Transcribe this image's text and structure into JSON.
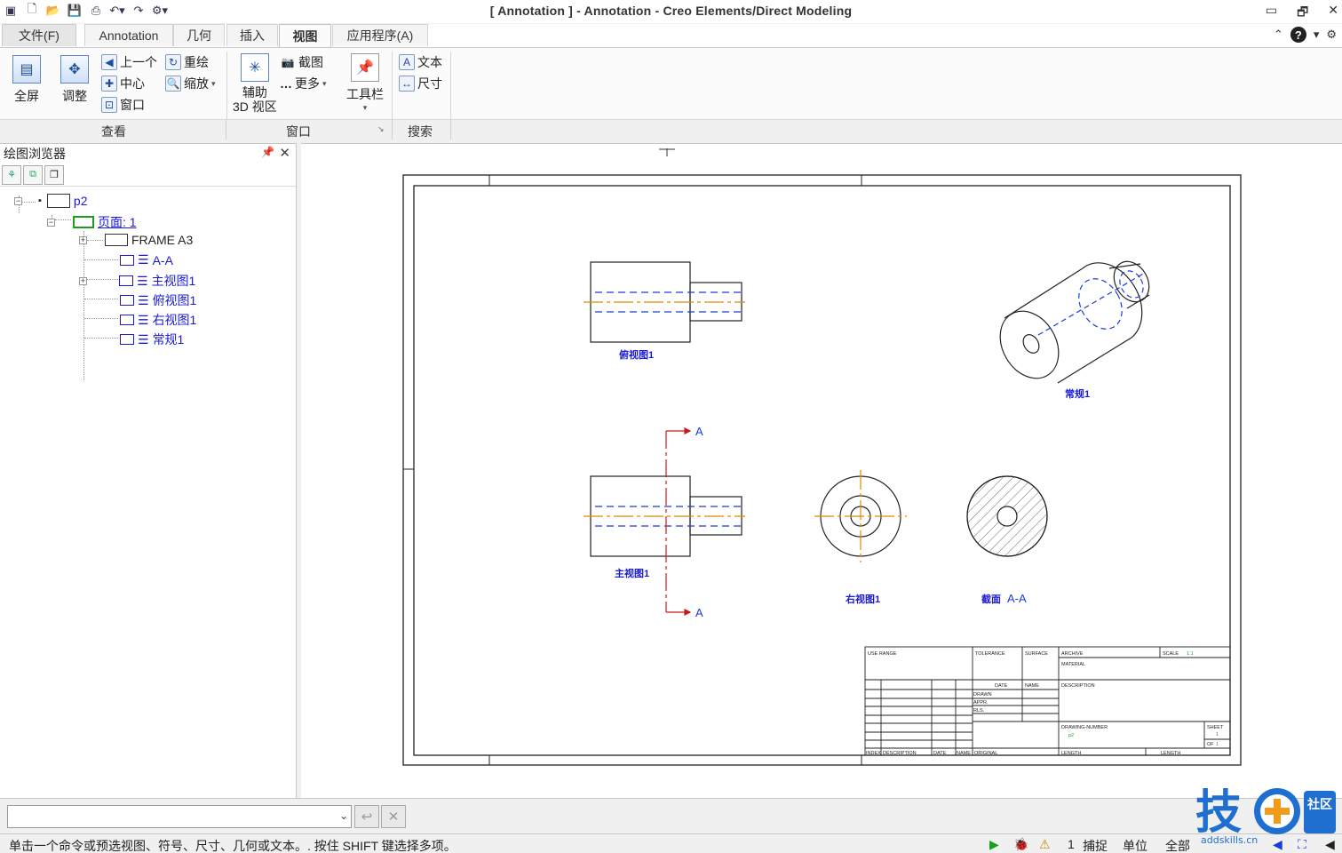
{
  "window": {
    "title": "[ Annotation ] - Annotation - Creo Elements/Direct Modeling",
    "controls": [
      "▭",
      "🗗",
      "✕"
    ]
  },
  "quick_access": [
    "app-icon",
    "new-icon",
    "open-icon",
    "save-icon",
    "print-icon",
    "undo-icon",
    "redo-icon",
    "customize-icon"
  ],
  "tabs": [
    {
      "label": "文件(F)",
      "active": false
    },
    {
      "label": "Annotation",
      "active": false
    },
    {
      "label": "几何",
      "active": false
    },
    {
      "label": "插入",
      "active": false
    },
    {
      "label": "视图",
      "active": true
    },
    {
      "label": "应用程序(A)",
      "active": false
    }
  ],
  "ribbon": {
    "fullscreen": "全屏",
    "adjust": "调整",
    "prev": "上一个",
    "center": "中心",
    "window_btn": "窗口",
    "redraw": "重绘",
    "zoom": "缩放",
    "aux3d_line1": "辅助",
    "aux3d_line2": "3D 视区",
    "screenshot": "截图",
    "more": "更多",
    "toolbar": "工具栏",
    "text": "文本",
    "dimension": "尺寸",
    "groups": {
      "view": "查看",
      "window": "窗口",
      "search": "搜索"
    }
  },
  "browser": {
    "title": "绘图浏览器",
    "tree": {
      "root": "p2",
      "page": "页面: 1",
      "frame": "FRAME A3",
      "views": [
        "A-A",
        "主视图1",
        "俯视图1",
        "右视图1",
        "常规1"
      ]
    }
  },
  "drawing": {
    "view_labels": {
      "top": "俯视图1",
      "general": "常规1",
      "front": "主视图1",
      "right": "右视图1",
      "section_prefix": "截面",
      "section_name": "A-A",
      "cut_top": "A",
      "cut_bottom": "A"
    },
    "title_block": {
      "use_range": "USE RANGE",
      "tolerance": "TOLERANCE",
      "surface": "SURFACE",
      "archive": "ARCHIVE",
      "scale": "SCALE",
      "scale_value": "1:1",
      "material": "MATERIAL",
      "date": "DATE",
      "name": "NAME",
      "description": "DESCRIPTION",
      "drawn": "DRAWN",
      "appr": "APPR.",
      "rls": "RLS.",
      "drawing_number": "DRAWING-NUMBER",
      "drawing_number_value": "p2",
      "sheet": "SHEET",
      "sheet_value": "1",
      "of": "OF",
      "of_value": "1",
      "index": "INDEX",
      "desc_short": "DESCRIPTION",
      "date2": "DATE",
      "name2": "NAME",
      "original": "ORIGINAL",
      "length": "LENGTH",
      "lengthunit": "LENGTH"
    }
  },
  "status": {
    "message": "单击一个命令或预选视图、符号、尺寸、几何或文本。. 按住 SHIFT 键选择多项。",
    "count": "1",
    "snap": "捕捉",
    "unit": "单位",
    "all": "全部"
  },
  "watermark": {
    "main": "技",
    "side": "社区",
    "url": "addskills.cn"
  },
  "colors": {
    "tree_link": "#1a1ad6",
    "hidden_line": "#1a3cd6",
    "center_line": "#e08a00",
    "section_line": "#c41a1a"
  }
}
